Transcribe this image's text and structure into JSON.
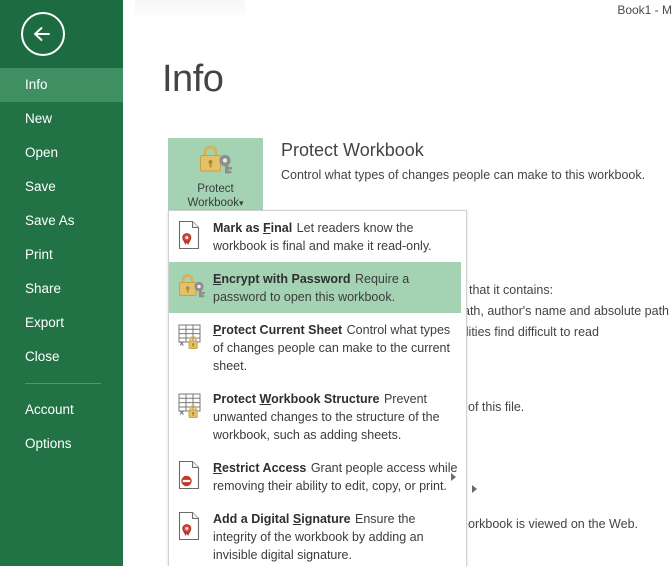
{
  "window": {
    "title": "Book1 - M"
  },
  "sidebar": {
    "back_label": "Back",
    "items": [
      {
        "label": "Info",
        "active": true
      },
      {
        "label": "New",
        "active": false
      },
      {
        "label": "Open",
        "active": false
      },
      {
        "label": "Save",
        "active": false
      },
      {
        "label": "Save As",
        "active": false
      },
      {
        "label": "Print",
        "active": false
      },
      {
        "label": "Share",
        "active": false
      },
      {
        "label": "Export",
        "active": false
      },
      {
        "label": "Close",
        "active": false
      }
    ],
    "items_bottom": [
      {
        "label": "Account"
      },
      {
        "label": "Options"
      }
    ]
  },
  "main": {
    "page_title": "Info",
    "protect_button": {
      "line1": "Protect",
      "line2": "Workbook",
      "caret": "▾"
    },
    "protect_section": {
      "heading": "Protect Workbook",
      "description": "Control what types of changes people can make to this workbook."
    },
    "background_text": {
      "inspect_line1": "that it contains:",
      "inspect_line2": "ath, author's name and absolute path",
      "inspect_line3": "ilities find difficult to read",
      "versions_line": "of this file.",
      "browser_line": "orkbook is viewed on the Web."
    }
  },
  "menu": {
    "items": [
      {
        "icon": "document-ribbon-icon",
        "title_pre": "Mark as ",
        "title_key": "F",
        "title_post": "inal",
        "desc": "Let readers know the workbook is final and make it read-only.",
        "highlighted": false,
        "has_submenu": false
      },
      {
        "icon": "lock-key-icon",
        "title_pre": "",
        "title_key": "E",
        "title_post": "ncrypt with Password",
        "desc": "Require a password to open this workbook.",
        "highlighted": true,
        "has_submenu": false
      },
      {
        "icon": "sheet-lock-icon",
        "title_pre": "",
        "title_key": "P",
        "title_post": "rotect Current Sheet",
        "desc": "Control what types of changes people can make to the current sheet.",
        "highlighted": false,
        "has_submenu": false
      },
      {
        "icon": "workbook-lock-icon",
        "title_pre": "Protect ",
        "title_key": "W",
        "title_post": "orkbook Structure",
        "desc": "Prevent unwanted changes to the structure of the workbook, such as adding sheets.",
        "highlighted": false,
        "has_submenu": false
      },
      {
        "icon": "document-restrict-icon",
        "title_pre": "",
        "title_key": "R",
        "title_post": "estrict Access",
        "desc": "Grant people access while removing their ability to edit, copy, or print.",
        "highlighted": false,
        "has_submenu": true
      },
      {
        "icon": "document-signature-icon",
        "title_pre": "Add a Digital ",
        "title_key": "S",
        "title_post": "ignature",
        "desc": "Ensure the integrity of the workbook by adding an invisible digital signature.",
        "highlighted": false,
        "has_submenu": false
      }
    ]
  },
  "colors": {
    "sidebar_green": "#217346",
    "sidebar_active": "#3f8f63",
    "highlight_green": "#a3d3b2",
    "lock_gold": "#d8a93f",
    "text_dark": "#444444"
  }
}
